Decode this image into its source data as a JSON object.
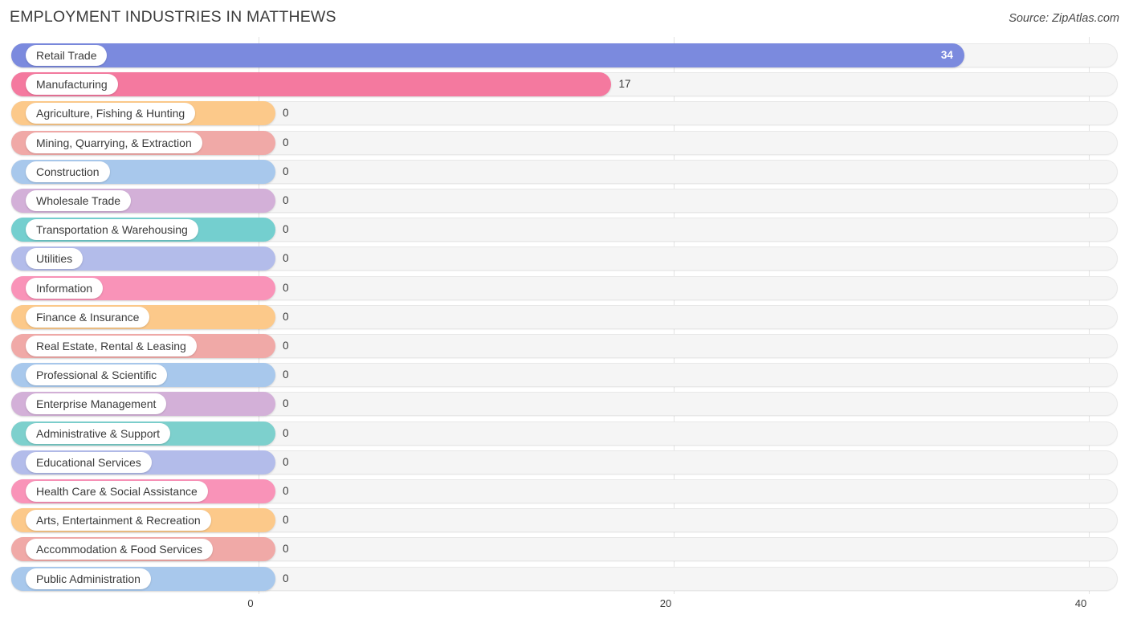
{
  "header": {
    "title": "EMPLOYMENT INDUSTRIES IN MATTHEWS",
    "source": "Source: ZipAtlas.com"
  },
  "chart_data": {
    "type": "bar",
    "orientation": "horizontal",
    "title": "EMPLOYMENT INDUSTRIES IN MATTHEWS",
    "xlabel": "",
    "ylabel": "",
    "xlim": [
      0,
      40
    ],
    "xticks": [
      0,
      20,
      40
    ],
    "xtick_labels": [
      "0",
      "20",
      "40"
    ],
    "grid": true,
    "legend": "none",
    "categories": [
      "Retail Trade",
      "Manufacturing",
      "Agriculture, Fishing & Hunting",
      "Mining, Quarrying, & Extraction",
      "Construction",
      "Wholesale Trade",
      "Transportation & Warehousing",
      "Utilities",
      "Information",
      "Finance & Insurance",
      "Real Estate, Rental & Leasing",
      "Professional & Scientific",
      "Enterprise Management",
      "Administrative & Support",
      "Educational Services",
      "Health Care & Social Assistance",
      "Arts, Entertainment & Recreation",
      "Accommodation & Food Services",
      "Public Administration"
    ],
    "values": [
      34,
      17,
      0,
      0,
      0,
      0,
      0,
      0,
      0,
      0,
      0,
      0,
      0,
      0,
      0,
      0,
      0,
      0,
      0
    ],
    "value_labels": [
      "34",
      "17",
      "0",
      "0",
      "0",
      "0",
      "0",
      "0",
      "0",
      "0",
      "0",
      "0",
      "0",
      "0",
      "0",
      "0",
      "0",
      "0",
      "0"
    ],
    "colors": [
      "#7b8ade",
      "#f4799f",
      "#fcc98a",
      "#f0a9a7",
      "#a8c8ec",
      "#d3b0d8",
      "#74cfcf",
      "#b3bcea",
      "#f993b8",
      "#fcc98a",
      "#f0a9a7",
      "#a8c8ec",
      "#d3b0d8",
      "#7dd0cd",
      "#b3bcea",
      "#f993b8",
      "#fcc98a",
      "#f0a9a7",
      "#a8c8ec"
    ]
  },
  "rows": [
    {
      "label": "Retail Trade",
      "value": 34,
      "value_label": "34",
      "color": "#7b8ade",
      "inside": true
    },
    {
      "label": "Manufacturing",
      "value": 17,
      "value_label": "17",
      "color": "#f4799f",
      "inside": false
    },
    {
      "label": "Agriculture, Fishing & Hunting",
      "value": 0,
      "value_label": "0",
      "color": "#fcc98a",
      "inside": false
    },
    {
      "label": "Mining, Quarrying, & Extraction",
      "value": 0,
      "value_label": "0",
      "color": "#f0a9a7",
      "inside": false
    },
    {
      "label": "Construction",
      "value": 0,
      "value_label": "0",
      "color": "#a8c8ec",
      "inside": false
    },
    {
      "label": "Wholesale Trade",
      "value": 0,
      "value_label": "0",
      "color": "#d3b0d8",
      "inside": false
    },
    {
      "label": "Transportation & Warehousing",
      "value": 0,
      "value_label": "0",
      "color": "#74cfcf",
      "inside": false
    },
    {
      "label": "Utilities",
      "value": 0,
      "value_label": "0",
      "color": "#b3bcea",
      "inside": false
    },
    {
      "label": "Information",
      "value": 0,
      "value_label": "0",
      "color": "#f993b8",
      "inside": false
    },
    {
      "label": "Finance & Insurance",
      "value": 0,
      "value_label": "0",
      "color": "#fcc98a",
      "inside": false
    },
    {
      "label": "Real Estate, Rental & Leasing",
      "value": 0,
      "value_label": "0",
      "color": "#f0a9a7",
      "inside": false
    },
    {
      "label": "Professional & Scientific",
      "value": 0,
      "value_label": "0",
      "color": "#a8c8ec",
      "inside": false
    },
    {
      "label": "Enterprise Management",
      "value": 0,
      "value_label": "0",
      "color": "#d3b0d8",
      "inside": false
    },
    {
      "label": "Administrative & Support",
      "value": 0,
      "value_label": "0",
      "color": "#7dd0cd",
      "inside": false
    },
    {
      "label": "Educational Services",
      "value": 0,
      "value_label": "0",
      "color": "#b3bcea",
      "inside": false
    },
    {
      "label": "Health Care & Social Assistance",
      "value": 0,
      "value_label": "0",
      "color": "#f993b8",
      "inside": false
    },
    {
      "label": "Arts, Entertainment & Recreation",
      "value": 0,
      "value_label": "0",
      "color": "#fcc98a",
      "inside": false
    },
    {
      "label": "Accommodation & Food Services",
      "value": 0,
      "value_label": "0",
      "color": "#f0a9a7",
      "inside": false
    },
    {
      "label": "Public Administration",
      "value": 0,
      "value_label": "0",
      "color": "#a8c8ec",
      "inside": false
    }
  ],
  "axis": {
    "ticks": [
      "0",
      "20",
      "40"
    ]
  }
}
